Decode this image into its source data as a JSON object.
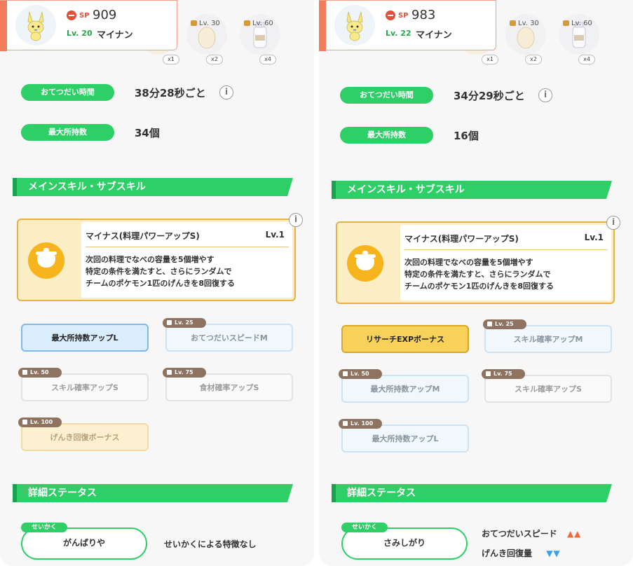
{
  "left": {
    "sp_label": "SP",
    "sp_value": "909",
    "level": "Lv. 20",
    "name": "マイナン",
    "ingredients": [
      {
        "lv": "",
        "count": "x1"
      },
      {
        "lv": "Lv. 30",
        "count": "x2"
      },
      {
        "lv": "Lv. 60",
        "count": "x4"
      }
    ],
    "help_time_label": "おてつだい時間",
    "help_time_value": "38分28秒ごと",
    "max_carry_label": "最大所持数",
    "max_carry_value": "34個",
    "skill_banner": "メインスキル・サブスキル",
    "main_skill": {
      "title": "マイナス(料理パワーアップS)",
      "level": "Lv.1",
      "desc_line1": "次回の料理でなべの容量を5個増やす",
      "desc_line2": "特定の条件を満たすと、さらにランダムで",
      "desc_line3": "チームのポケモン1匹のげんきを8回復する"
    },
    "sub_skills": [
      {
        "label": "最大所持数アップL",
        "lv": ""
      },
      {
        "label": "おてつだいスピードM",
        "lv": "Lv. 25"
      },
      {
        "label": "スキル確率アップS",
        "lv": "Lv. 50"
      },
      {
        "label": "食材確率アップS",
        "lv": "Lv. 75"
      },
      {
        "label": "げんき回復ボーナス",
        "lv": "Lv. 100"
      }
    ],
    "status_banner": "詳細ステータス",
    "nature_tag": "せいかく",
    "nature": "がんばりや",
    "nature_note": "せいかくによる特徴なし"
  },
  "right": {
    "sp_label": "SP",
    "sp_value": "983",
    "level": "Lv. 22",
    "name": "マイナン",
    "ingredients": [
      {
        "lv": "",
        "count": "x1"
      },
      {
        "lv": "Lv. 30",
        "count": "x2"
      },
      {
        "lv": "Lv. 60",
        "count": "x4"
      }
    ],
    "help_time_label": "おてつだい時間",
    "help_time_value": "34分29秒ごと",
    "max_carry_label": "最大所持数",
    "max_carry_value": "16個",
    "skill_banner": "メインスキル・サブスキル",
    "main_skill": {
      "title": "マイナス(料理パワーアップS)",
      "level": "Lv.1",
      "desc_line1": "次回の料理でなべの容量を5個増やす",
      "desc_line2": "特定の条件を満たすと、さらにランダムで",
      "desc_line3": "チームのポケモン1匹のげんきを8回復する"
    },
    "sub_skills": [
      {
        "label": "リサーチEXPボーナス",
        "lv": ""
      },
      {
        "label": "スキル確率アップM",
        "lv": "Lv. 25"
      },
      {
        "label": "最大所持数アップM",
        "lv": "Lv. 50"
      },
      {
        "label": "スキル確率アップS",
        "lv": "Lv. 75"
      },
      {
        "label": "最大所持数アップL",
        "lv": "Lv. 100"
      }
    ],
    "status_banner": "詳細ステータス",
    "nature_tag": "せいかく",
    "nature": "さみしがり",
    "nature_up_label": "おてつだいスピード",
    "nature_up_arrows": "▲▲",
    "nature_down_label": "げんき回復量",
    "nature_down_arrows": "▼▼"
  },
  "info_glyph": "i",
  "colors": {
    "accent_green": "#2ecf66",
    "header_orange": "#f07c5a",
    "skill_gold": "#e3b34a",
    "sub_blue": "#7fb9ea",
    "lv_badge_brown": "#8e7361"
  }
}
